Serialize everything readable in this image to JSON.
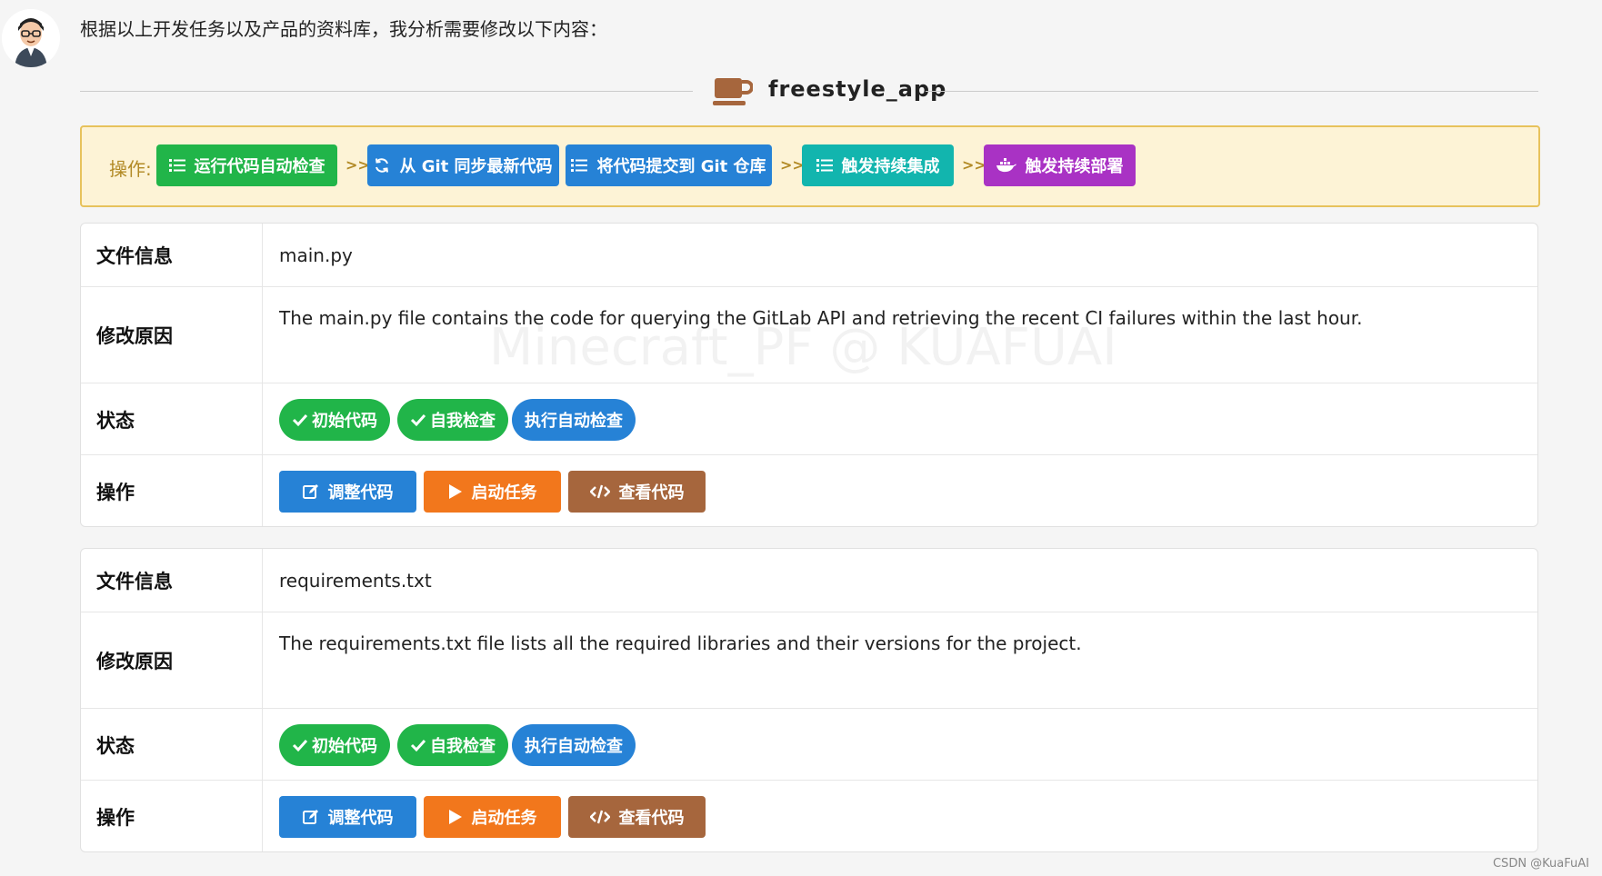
{
  "message": {
    "intro": "根据以上开发任务以及产品的资料库，我分析需要修改以下内容："
  },
  "header": {
    "app_name": "freestyle_app",
    "icon": "coffee-cup-icon"
  },
  "ops": {
    "label": "操作:",
    "arrow": ">>",
    "buttons": [
      {
        "label": "运行代码自动检查",
        "icon": "list-check-icon",
        "color": "#21b549"
      },
      {
        "label": "从 Git 同步最新代码",
        "icon": "sync-icon",
        "color": "#2682d6"
      },
      {
        "label": "将代码提交到 Git 仓库",
        "icon": "list-check-icon",
        "color": "#2682d6"
      },
      {
        "label": "触发持续集成",
        "icon": "list-check-icon",
        "color": "#12b5ae"
      },
      {
        "label": "触发持续部署",
        "icon": "docker-icon",
        "color": "#a932c4"
      }
    ]
  },
  "files": [
    {
      "file_label": "文件信息",
      "file_name": "main.py",
      "reason_label": "修改原因",
      "reason": "The main.py file contains the code for querying the GitLab API and retrieving the recent CI failures within the last hour.",
      "status_label": "状态",
      "statuses": [
        {
          "label": "初始代码",
          "done": true,
          "color": "#21b549"
        },
        {
          "label": "自我检查",
          "done": true,
          "color": "#21b549"
        },
        {
          "label": "执行自动检查",
          "done": false,
          "color": "#2682d6"
        }
      ],
      "action_label": "操作",
      "actions": [
        {
          "label": "调整代码",
          "icon": "edit-icon",
          "color": "#2682d6"
        },
        {
          "label": "启动任务",
          "icon": "play-icon",
          "color": "#f2771c"
        },
        {
          "label": "查看代码",
          "icon": "code-icon",
          "color": "#a6663d"
        }
      ]
    },
    {
      "file_label": "文件信息",
      "file_name": "requirements.txt",
      "reason_label": "修改原因",
      "reason": "The requirements.txt file lists all the required libraries and their versions for the project.",
      "status_label": "状态",
      "statuses": [
        {
          "label": "初始代码",
          "done": true,
          "color": "#21b549"
        },
        {
          "label": "自我检查",
          "done": true,
          "color": "#21b549"
        },
        {
          "label": "执行自动检查",
          "done": false,
          "color": "#2682d6"
        }
      ],
      "action_label": "操作",
      "actions": [
        {
          "label": "调整代码",
          "icon": "edit-icon",
          "color": "#2682d6"
        },
        {
          "label": "启动任务",
          "icon": "play-icon",
          "color": "#f2771c"
        },
        {
          "label": "查看代码",
          "icon": "code-icon",
          "color": "#a6663d"
        }
      ]
    }
  ],
  "watermark": "Minecraft_PF @ KUAFUAI",
  "footer": {
    "csdn": "CSDN @KuaFuAI"
  }
}
